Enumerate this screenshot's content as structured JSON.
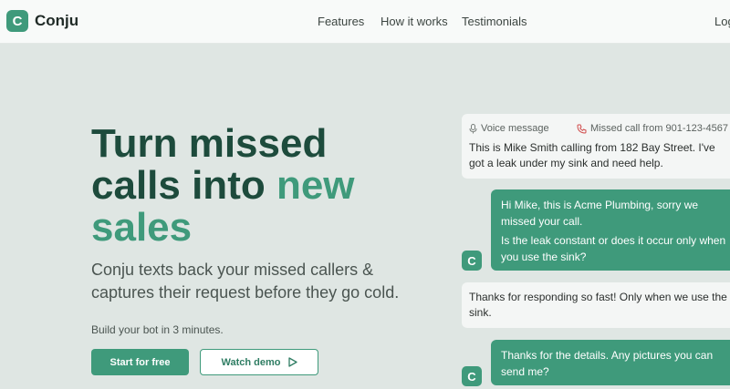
{
  "brand": {
    "logo_letter": "C",
    "name": "Conju",
    "color": "#3f9a7b"
  },
  "nav": {
    "features": "Features",
    "how_it_works": "How it works",
    "testimonials": "Testimonials",
    "login": "Log"
  },
  "hero": {
    "headline_dark": "Turn missed calls into",
    "headline_accent": "new sales",
    "subhead": "Conju texts back your missed callers & captures their request before they go cold.",
    "note": "Build your bot in 3 minutes.",
    "primary_button": "Start for free",
    "secondary_button": "Watch demo"
  },
  "chat": {
    "voice_label": "Voice message",
    "missed_call_label": "Missed call from 901-123-4567",
    "message1": "This is Mike Smith calling from 182 Bay Street. I've got a leak under my sink and need help.",
    "reply1_line1": "Hi Mike, this is Acme Plumbing, sorry we missed your call.",
    "reply1_line2": "Is the leak constant or does it occur only when you use the sink?",
    "message2": "Thanks for responding so fast! Only when we use the sink.",
    "reply2": "Thanks for the details. Any pictures you can send me?",
    "avatar_letter": "C"
  }
}
